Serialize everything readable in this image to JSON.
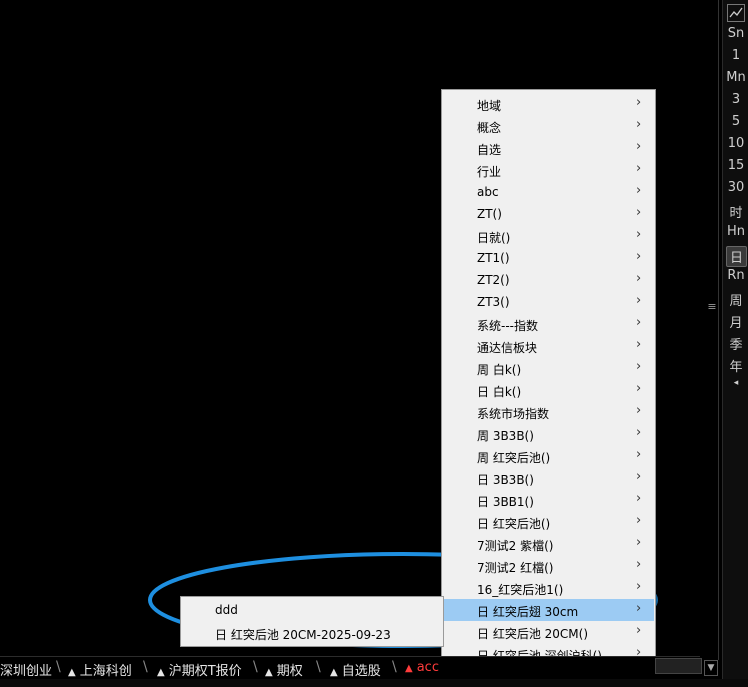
{
  "right_toolbar": {
    "items": [
      "Sn",
      "1",
      "Mn",
      "3",
      "5",
      "10",
      "15",
      "30",
      "时",
      "Hn",
      "日",
      "Rn",
      "周",
      "月",
      "季",
      "年"
    ],
    "selected": "日"
  },
  "context_menu": {
    "items": [
      "地域",
      "概念",
      "自选",
      "行业",
      "abc",
      "ZT()",
      "日就()",
      "ZT1()",
      "ZT2()",
      "ZT3()",
      "系统---指数",
      "通达信板块",
      "周 白k()",
      "日 白k()",
      "系统市场指数",
      "周 3B3B()",
      "周 红突后池()",
      "日 3B3B()",
      "日 3BB1()",
      "日 红突后池()",
      "7测试2 紫檔()",
      "7测试2 红檔()",
      "16_红突后池1()",
      "日 红突后翅 30cm",
      "日 红突后池 20CM()",
      "日 红突后池 深创沪科()"
    ],
    "highlighted_index": 23,
    "arrow": "›"
  },
  "submenu": {
    "items": [
      "ddd",
      "日 红突后池 20CM-2025-09-23"
    ]
  },
  "tab_bar": {
    "tabs": [
      "深圳创业",
      "上海科创",
      "沪期权T报价",
      "期权",
      "自选股",
      "acc"
    ],
    "active_index": 5,
    "active_color": "#ff3b3b"
  },
  "annotation": {
    "color": "#1e8fe0"
  }
}
